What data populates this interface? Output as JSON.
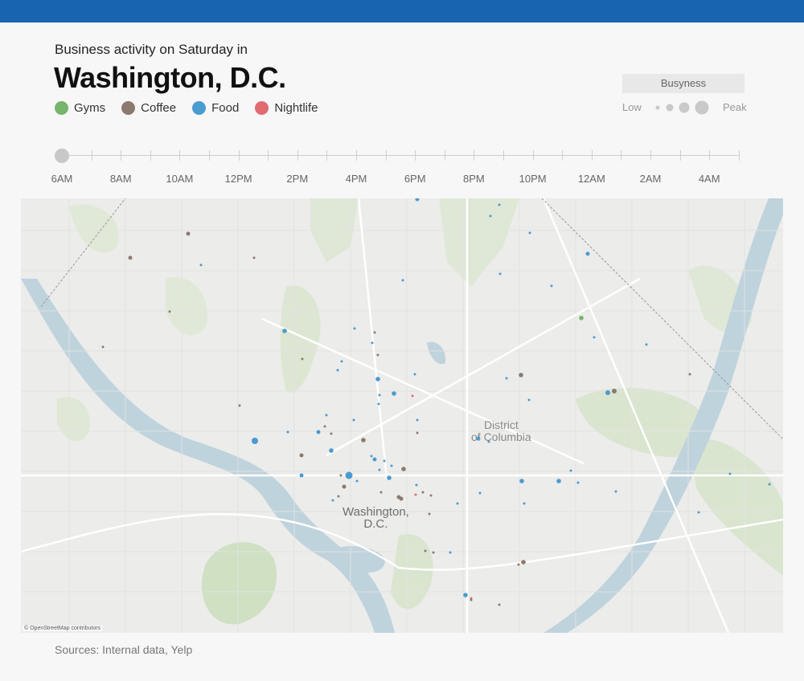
{
  "header": {
    "subtitle": "Business activity on Saturday in",
    "title": "Washington, D.C."
  },
  "legend": [
    {
      "label": "Gyms",
      "color": "#77b46c"
    },
    {
      "label": "Coffee",
      "color": "#8c7a6e"
    },
    {
      "label": "Food",
      "color": "#4a9bcf"
    },
    {
      "label": "Nightlife",
      "color": "#e06b70"
    }
  ],
  "busyness": {
    "title": "Busyness",
    "low": "Low",
    "peak": "Peak"
  },
  "timeline": {
    "labels": [
      "6AM",
      "8AM",
      "10AM",
      "12PM",
      "2PM",
      "4PM",
      "6PM",
      "8PM",
      "10PM",
      "12AM",
      "2AM",
      "4AM"
    ],
    "current": "6AM"
  },
  "map": {
    "district_label_1": "District",
    "district_label_2": "of Columbia",
    "city_label_1": "Washington,",
    "city_label_2": "D.C.",
    "attribution": "© OpenStreetMap contributors"
  },
  "sources": "Sources: Internal data, Yelp"
}
